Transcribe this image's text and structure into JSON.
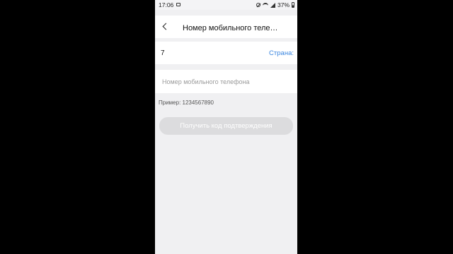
{
  "status_bar": {
    "time": "17:06",
    "battery": "37%"
  },
  "header": {
    "title": "Номер мобильного теле…"
  },
  "country": {
    "code": "7",
    "link_label": "Страна:"
  },
  "phone_field": {
    "placeholder": "Номер мобильного телефона",
    "value": ""
  },
  "hint": "Пример: 1234567890",
  "confirm_button": {
    "label": "Получить код подтверждения"
  },
  "colors": {
    "accent": "#3a86e0",
    "button_disabled": "#dcdcde",
    "background": "#f0f0f2"
  }
}
